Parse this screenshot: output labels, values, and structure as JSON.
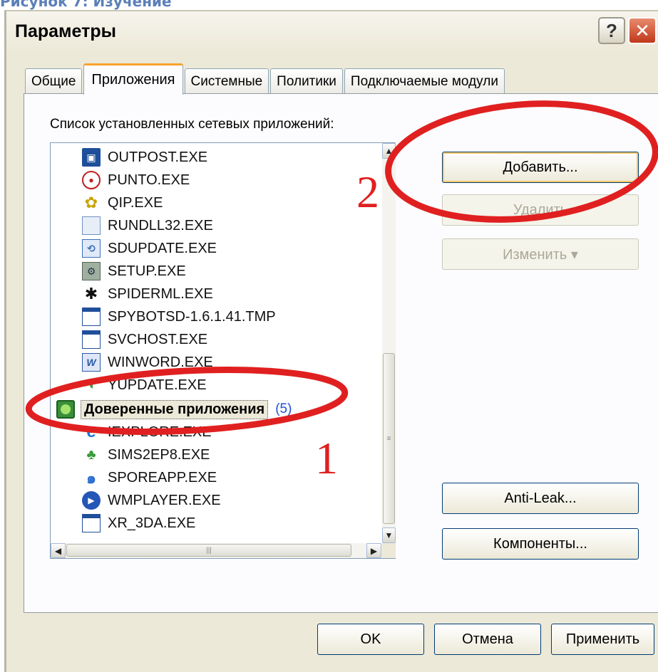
{
  "caption": "Рисунок 7: Изучение",
  "window": {
    "title": "Параметры",
    "help_icon": "?",
    "close_icon": "✕"
  },
  "tabs": [
    {
      "label": "Общие"
    },
    {
      "label": "Приложения"
    },
    {
      "label": "Системные"
    },
    {
      "label": "Политики"
    },
    {
      "label": "Подключаемые модули"
    }
  ],
  "list": {
    "caption": "Список установленных сетевых приложений:",
    "items": [
      {
        "label": "OUTPOST.EXE",
        "icon": "outpost-icon"
      },
      {
        "label": "PUNTO.EXE",
        "icon": "punto-icon"
      },
      {
        "label": "QIP.EXE",
        "icon": "qip-icon"
      },
      {
        "label": "RUNDLL32.EXE",
        "icon": "file-icon"
      },
      {
        "label": "SDUPDATE.EXE",
        "icon": "sdupdate-icon"
      },
      {
        "label": "SETUP.EXE",
        "icon": "setup-icon"
      },
      {
        "label": "SPIDERML.EXE",
        "icon": "spider-icon"
      },
      {
        "label": "SPYBOTSD-1.6.1.41.TMP",
        "icon": "window-icon"
      },
      {
        "label": "SVCHOST.EXE",
        "icon": "window-icon"
      },
      {
        "label": "WINWORD.EXE",
        "icon": "word-icon"
      },
      {
        "label": "YUPDATE.EXE",
        "icon": "yupdate-icon"
      }
    ],
    "group": {
      "label": "Доверенные приложения",
      "count": "(5)"
    },
    "group_items": [
      {
        "label": "IEXPLORE.EXE",
        "icon": "ie-icon"
      },
      {
        "label": "SIMS2EP8.EXE",
        "icon": "sims-icon"
      },
      {
        "label": "SPOREAPP.EXE",
        "icon": "spore-icon"
      },
      {
        "label": "WMPLAYER.EXE",
        "icon": "wmplayer-icon"
      },
      {
        "label": "XR_3DA.EXE",
        "icon": "window-icon"
      }
    ]
  },
  "buttons": {
    "add": "Добавить...",
    "remove": "Удалить",
    "edit": "Изменить ▾",
    "anti_leak": "Anti-Leak...",
    "components": "Компоненты...",
    "ok": "OK",
    "cancel": "Отмена",
    "apply": "Применить"
  },
  "annotations": {
    "one": "1",
    "two": "2"
  },
  "colors": {
    "annotation": "#e02020",
    "dialog_bg": "#ece9d8",
    "group_count": "#1f4fd1"
  }
}
